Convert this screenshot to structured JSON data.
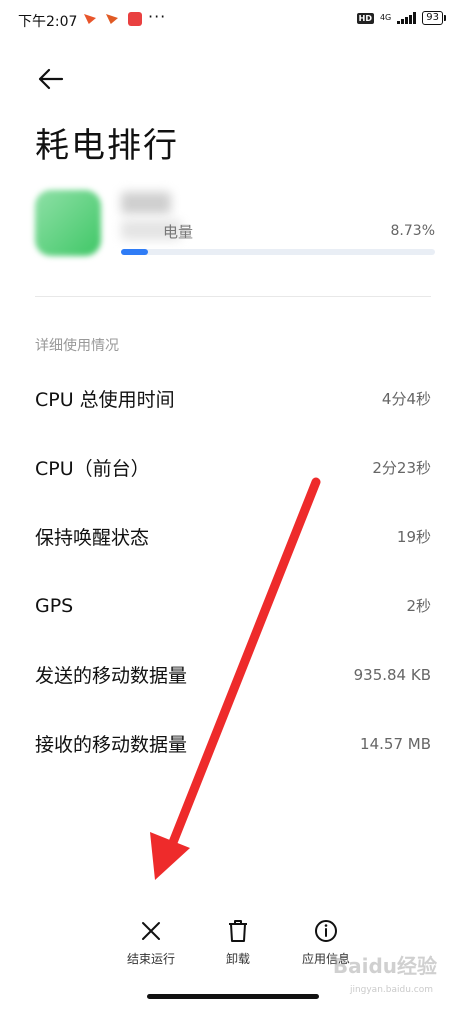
{
  "status_bar": {
    "time": "下午2:07",
    "more": "···",
    "hd": "HD",
    "network": "4G",
    "battery": "93"
  },
  "page": {
    "title": "耗电排行"
  },
  "app": {
    "usage_label": "电量",
    "percent": "8.73%",
    "progress": 0.0873
  },
  "details": {
    "section_title": "详细使用情况",
    "rows": [
      {
        "label": "CPU 总使用时间",
        "value": "4分4秒"
      },
      {
        "label": "CPU（前台）",
        "value": "2分23秒"
      },
      {
        "label": "保持唤醒状态",
        "value": "19秒"
      },
      {
        "label": "GPS",
        "value": "2秒"
      },
      {
        "label": "发送的移动数据量",
        "value": "935.84 KB"
      },
      {
        "label": "接收的移动数据量",
        "value": "14.57 MB"
      }
    ]
  },
  "actions": {
    "force_stop": "结束运行",
    "uninstall": "卸载",
    "app_info": "应用信息"
  },
  "watermark": {
    "text": "Baidu经验",
    "sub": "jingyan.baidu.com"
  },
  "icons": [
    "back-arrow-icon",
    "close-icon",
    "trash-icon",
    "info-icon"
  ],
  "colors": {
    "accent": "#2f7cf6",
    "annotation": "#ee2b2b"
  }
}
